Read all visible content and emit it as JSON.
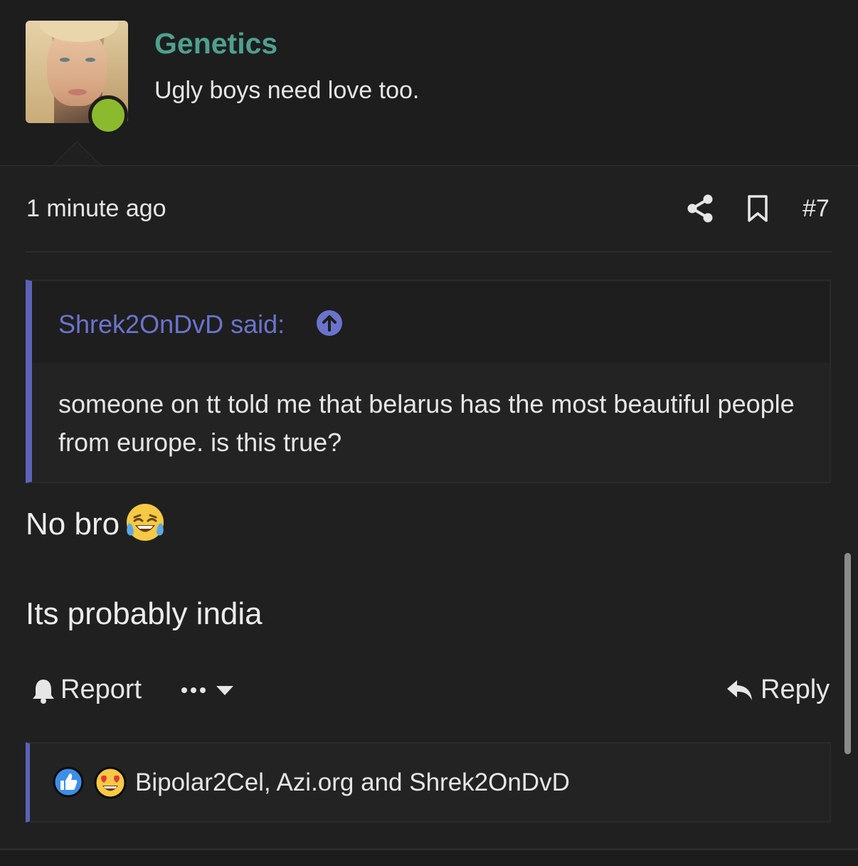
{
  "post": {
    "username": "Genetics",
    "user_title": "Ugly boys need love too.",
    "timestamp": "1 minute ago",
    "post_number": "#7"
  },
  "quote": {
    "author_line": "Shrek2OnDvD said:",
    "text": "someone on tt told me that belarus has the most beautiful people from europe. is this true?"
  },
  "content": {
    "line1": "No bro",
    "line2": "Its probably india"
  },
  "actions": {
    "report_label": "Report",
    "reply_label": "Reply"
  },
  "reactions": {
    "users": "Bipolar2Cel, Azi.org and Shrek2OnDvD",
    "icons": [
      "like-icon",
      "love-icon"
    ]
  },
  "icons": [
    "share-icon",
    "bookmark-icon",
    "arrow-up-circle-icon",
    "bell-icon",
    "more-dots-icon",
    "chevron-down-icon",
    "reply-arrow-icon",
    "laughing-crying-emoji-icon"
  ],
  "colors": {
    "background": "#202020",
    "username": "#4fa08f",
    "quote_accent": "#5b62b8",
    "quote_author": "#6a74cc",
    "online": "#8bba2e"
  }
}
